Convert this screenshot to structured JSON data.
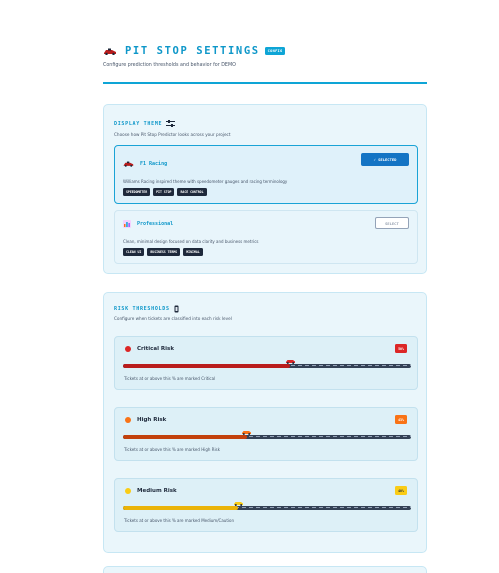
{
  "header": {
    "title": "PIT STOP SETTINGS",
    "badge": "CONFIG",
    "subtitle": "Configure prediction thresholds and behavior for DEMO"
  },
  "display_theme": {
    "title": "DISPLAY THEME",
    "description": "Choose how Pit Stop Predictor looks across your project",
    "options": [
      {
        "name": "F1 Racing",
        "description": "Williams Racing inspired theme with speedometer gauges and racing terminology",
        "chips": [
          "SPEEDOMETER",
          "PIT STOP",
          "RACE CONTROL"
        ],
        "button": "✓ SELECTED",
        "selected": true,
        "icon": "race-car-icon"
      },
      {
        "name": "Professional",
        "description": "Clean, minimal design focused on data clarity and business metrics",
        "chips": [
          "CLEAN UI",
          "BUSINESS TERMS",
          "MINIMAL"
        ],
        "button": "SELECT",
        "selected": false,
        "icon": "bar-chart-icon"
      }
    ]
  },
  "risk_thresholds": {
    "title": "RISK THRESHOLDS",
    "description": "Configure when tickets are classified into each risk level",
    "items": [
      {
        "name": "Critical Risk",
        "badge": "50%",
        "value_pct": 58,
        "help": "Tickets at or above this % are marked Critical",
        "color": "#dc2626",
        "fill": "#b91c1c",
        "badge_text": "#ffffff"
      },
      {
        "name": "High Risk",
        "badge": "43%",
        "value_pct": 43,
        "help": "Tickets at or above this % are marked High Risk",
        "color": "#f97316",
        "fill": "#c2410c",
        "badge_text": "#ffffff"
      },
      {
        "name": "Medium Risk",
        "badge": "40%",
        "value_pct": 40,
        "help": "Tickets at or above this % are marked Medium/Caution",
        "color": "#facc15",
        "fill": "#eab308",
        "badge_text": "#1e293b"
      }
    ]
  },
  "colors": {
    "accent": "#0ea5d6",
    "selected_button": "#1474c4",
    "chip_bg": "#1e293b"
  }
}
